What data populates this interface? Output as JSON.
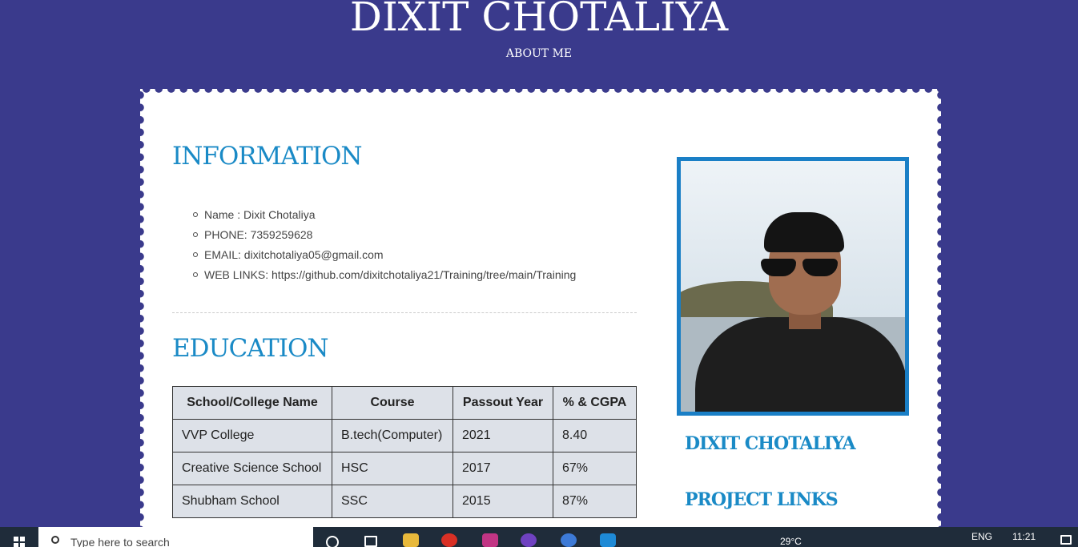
{
  "header": {
    "title": "DIXIT CHOTALIYA",
    "subtitle": "ABOUT ME"
  },
  "information": {
    "title": "INFORMATION",
    "items": [
      "Name : Dixit Chotaliya",
      "PHONE: 7359259628",
      "EMAIL: dixitchotaliya05@gmail.com",
      "WEB LINKS: https://github.com/dixitchotaliya21/Training/tree/main/Training"
    ]
  },
  "education": {
    "title": "EDUCATION",
    "columns": [
      "School/College Name",
      "Course",
      "Passout Year",
      "% & CGPA"
    ],
    "rows": [
      [
        "VVP College",
        "B.tech(Computer)",
        "2021",
        "8.40"
      ],
      [
        "Creative Science School",
        "HSC",
        "2017",
        "67%"
      ],
      [
        "Shubham School",
        "SSC",
        "2015",
        "87%"
      ]
    ]
  },
  "sidebar": {
    "name": "DIXIT CHOTALIYA",
    "project_links": "PROJECT LINKS"
  },
  "taskbar": {
    "search_placeholder": "Type here to search",
    "weather": "29°C",
    "language": "ENG",
    "time": "11:21",
    "icons": [
      "search-icon",
      "task-view-icon",
      "file-explorer-icon",
      "chrome-icon",
      "instagram-icon",
      "github-icon",
      "app-icon",
      "vscode-icon"
    ]
  },
  "colors": {
    "background": "#3a3a8c",
    "accent": "#1a8ac6",
    "photo_border": "#1a7fc6"
  }
}
